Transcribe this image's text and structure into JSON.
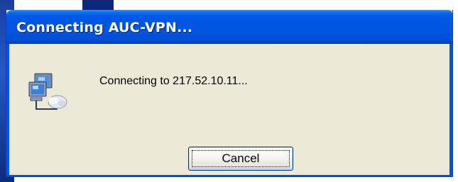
{
  "window": {
    "title": "Connecting AUC-VPN..."
  },
  "dialog": {
    "icon": "network-connection-icon",
    "message": "Connecting to 217.52.10.11..."
  },
  "buttons": {
    "cancel_label": "Cancel"
  },
  "colors": {
    "titlebar": "#0055e0",
    "dialog_background": "#ece9d8",
    "button_border": "#003c74"
  }
}
